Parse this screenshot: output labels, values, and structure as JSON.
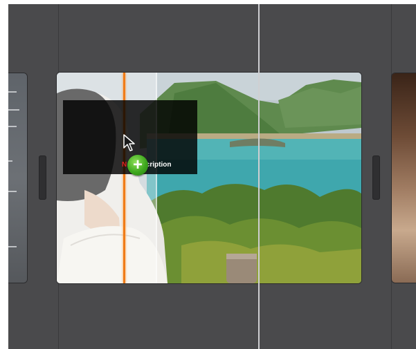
{
  "timeline": {
    "title_overlay": {
      "text_prefix": "N",
      "text_suffix": "scription"
    },
    "icons": {
      "cursor": "arrow-cursor-icon",
      "add": "add-plus-icon"
    },
    "add_symbol": "+",
    "colors": {
      "background": "#4a4a4c",
      "playhead": "#cfcfd2",
      "marker": "#f07c18",
      "add_badge": "#3ea81e"
    }
  }
}
